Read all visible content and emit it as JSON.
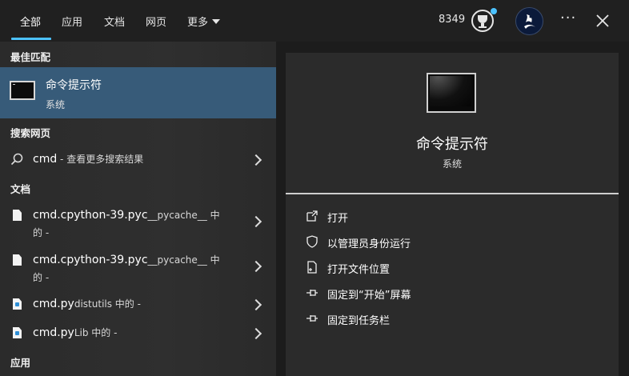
{
  "tabs": [
    {
      "label": "全部"
    },
    {
      "label": "应用"
    },
    {
      "label": "文档"
    },
    {
      "label": "网页"
    },
    {
      "label": "更多"
    }
  ],
  "header": {
    "points": "8349",
    "more_label": "···"
  },
  "sections": {
    "best_match": "最佳匹配",
    "web": "搜索网页",
    "docs": "文档",
    "apps": "应用"
  },
  "best_match": {
    "title": "命令提示符",
    "subtitle": "系统"
  },
  "web_result": {
    "query": "cmd",
    "suffix": " - 查看更多搜索结果"
  },
  "documents": [
    {
      "name": "cmd.cpython-39.pyc",
      "location": "__pycache__ 中",
      "line2": "的 -"
    },
    {
      "name": "cmd.cpython-39.pyc",
      "location": "__pycache__ 中",
      "line2": "的 -"
    },
    {
      "name": "cmd.py",
      "location": "distutils 中的 -"
    },
    {
      "name": "cmd.py",
      "location": "Lib 中的 -"
    }
  ],
  "preview": {
    "title": "命令提示符",
    "subtitle": "系统",
    "actions": [
      {
        "label": "打开",
        "icon": "open-icon"
      },
      {
        "label": "以管理员身份运行",
        "icon": "shield-icon"
      },
      {
        "label": "打开文件位置",
        "icon": "file-location-icon"
      },
      {
        "label": "固定到“开始”屏幕",
        "icon": "pin-icon"
      },
      {
        "label": "固定到任务栏",
        "icon": "pin-icon"
      }
    ]
  },
  "colors": {
    "accent": "#4cc2ff",
    "selection": "#375b79"
  }
}
